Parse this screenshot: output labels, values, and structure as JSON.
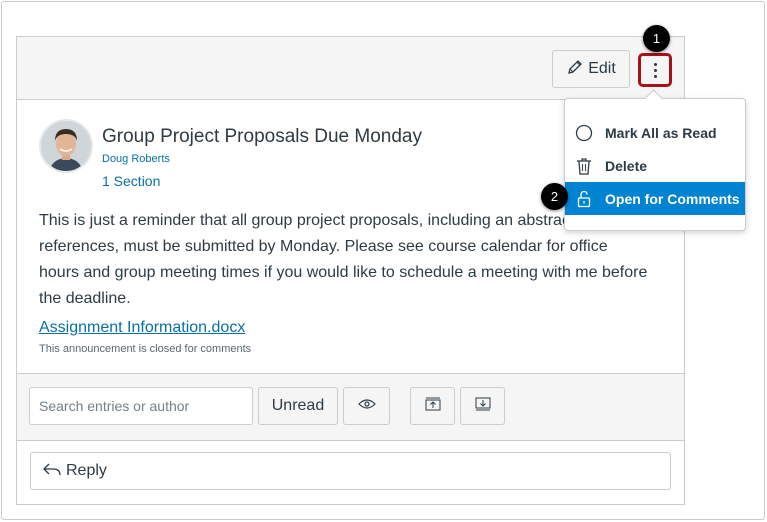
{
  "header": {
    "edit_label": "Edit"
  },
  "callouts": [
    "1",
    "2"
  ],
  "announcement": {
    "title": "Group Project Proposals Due Monday",
    "author": "Doug Roberts",
    "sections": "1 Section",
    "body": "This is just a reminder that all group project proposals, including an abstract and references, must be submitted by Monday. Please see course calendar for office hours and group meeting times if you would like to schedule a meeting with me before the deadline.",
    "attachment": "Assignment Information.docx",
    "closed_note": "This announcement is closed for comments"
  },
  "toolbar": {
    "search_placeholder": "Search entries or author",
    "unread_label": "Unread"
  },
  "reply": {
    "label": "Reply"
  },
  "menu": {
    "items": [
      {
        "label": "Mark All as Read",
        "icon": "circle-icon"
      },
      {
        "label": "Delete",
        "icon": "trash-icon"
      },
      {
        "label": "Open for Comments",
        "icon": "unlock-icon",
        "active": true
      }
    ]
  },
  "colors": {
    "accent": "#0084d1",
    "link": "#0770a3",
    "highlight_border": "#a7111a"
  }
}
